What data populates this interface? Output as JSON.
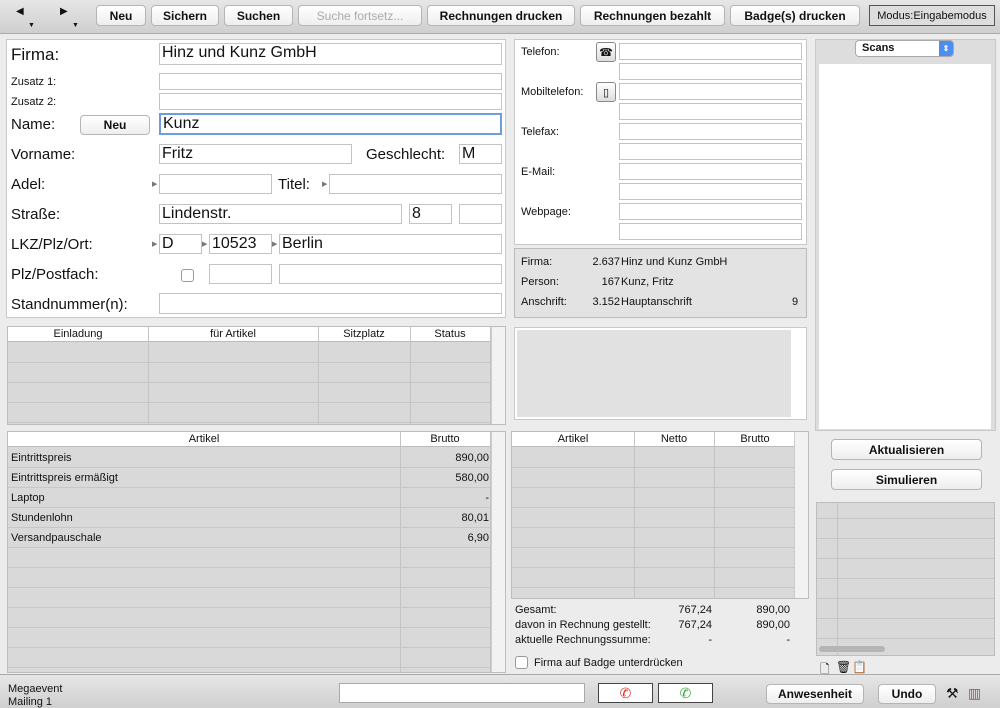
{
  "toolbar": {
    "new": "Neu",
    "save": "Sichern",
    "search": "Suchen",
    "search_continue": "Suche fortsetz...",
    "print_invoices": "Rechnungen drucken",
    "invoices_paid": "Rechnungen bezahlt",
    "print_badges": "Badge(s) drucken",
    "mode": "Modus:Eingabemodus"
  },
  "form": {
    "firma_label": "Firma:",
    "firma": "Hinz und Kunz GmbH",
    "zusatz1_label": "Zusatz 1:",
    "zusatz2_label": "Zusatz 2:",
    "name_label": "Name:",
    "name_new_button": "Neu",
    "name": "Kunz",
    "vorname_label": "Vorname:",
    "vorname": "Fritz",
    "geschlecht_label": "Geschlecht:",
    "geschlecht": "M",
    "adel_label": "Adel:",
    "titel_label": "Titel:",
    "strasse_label": "Straße:",
    "strasse": "Lindenstr.",
    "hausnr": "8",
    "lkz_label": "LKZ/Plz/Ort:",
    "lkz": "D",
    "plz": "10523",
    "ort": "Berlin",
    "postfach_label": "Plz/Postfach:",
    "standnummer_label": "Standnummer(n):"
  },
  "contact": {
    "telefon": "Telefon:",
    "mobil": "Mobiltelefon:",
    "telefax": "Telefax:",
    "email": "E-Mail:",
    "webpage": "Webpage:"
  },
  "info": {
    "firma_label": "Firma:",
    "firma_num": "2.637",
    "firma_name": "Hinz und Kunz GmbH",
    "person_label": "Person:",
    "person_num": "167",
    "person_name": "Kunz, Fritz",
    "anschrift_label": "Anschrift:",
    "anschrift_num": "3.152",
    "anschrift_name": "Hauptanschrift",
    "anschrift_extra": "9"
  },
  "invite_table": {
    "cols": [
      "Einladung",
      "für Artikel",
      "Sitzplatz",
      "Status"
    ]
  },
  "article_table": {
    "cols": [
      "Artikel",
      "Brutto"
    ],
    "rows": [
      {
        "a": "Eintrittspreis",
        "b": "890,00"
      },
      {
        "a": "Eintrittspreis ermäßigt",
        "b": "580,00"
      },
      {
        "a": "Laptop",
        "b": "-"
      },
      {
        "a": "Stundenlohn",
        "b": "80,01"
      },
      {
        "a": "Versandpauschale",
        "b": "6,90"
      }
    ]
  },
  "invoice_table": {
    "cols": [
      "Artikel",
      "Netto",
      "Brutto"
    ]
  },
  "totals": {
    "gesamt_label": "Gesamt:",
    "gesamt_netto": "767,24",
    "gesamt_brutto": "890,00",
    "davon_label": "davon in Rechnung gestellt:",
    "davon_netto": "767,24",
    "davon_brutto": "890,00",
    "aktuelle_label": "aktuelle Rechnungssumme:",
    "aktuelle_netto": "-",
    "aktuelle_brutto": "-"
  },
  "badge_checkbox": "Firma auf Badge unterdrücken",
  "scans": {
    "select": "Scans",
    "refresh": "Aktualisieren",
    "simulate": "Simulieren"
  },
  "footer": {
    "event": "Megaevent",
    "mailing": "Mailing 1",
    "attendance": "Anwesenheit",
    "undo": "Undo"
  },
  "colors": {
    "accent": "#6f9be0",
    "phone_red": "#d93030",
    "phone_green": "#3aa83a"
  }
}
